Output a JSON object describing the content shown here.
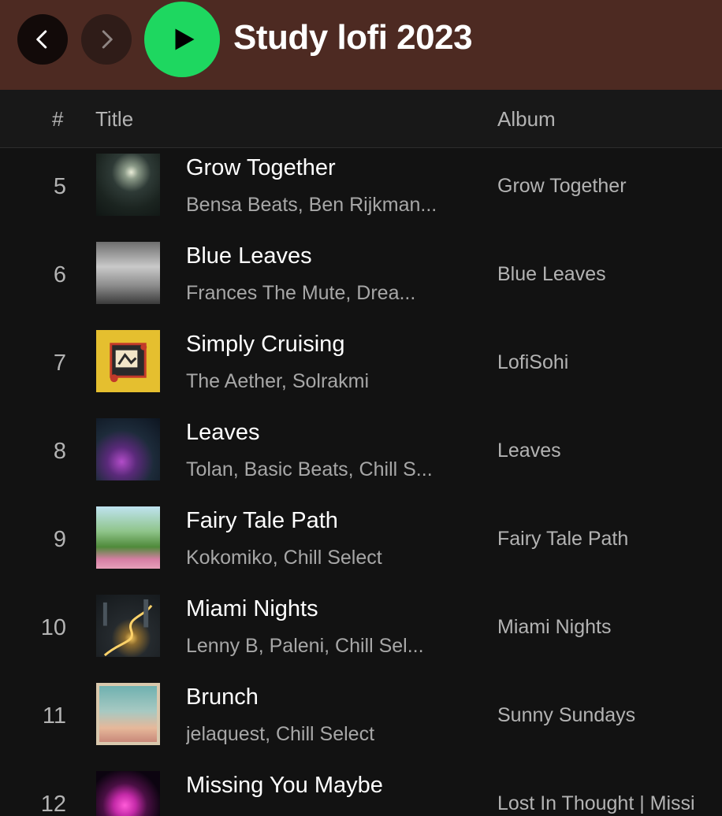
{
  "header": {
    "title": "Study lofi 2023",
    "back_icon": "chevron-left-icon",
    "forward_icon": "chevron-right-icon",
    "play_icon": "play-icon",
    "colors": {
      "header_bg": "#4d2a22",
      "play_green": "#1ed760"
    }
  },
  "columns": {
    "number": "#",
    "title": "Title",
    "album": "Album"
  },
  "tracks": [
    {
      "number": "5",
      "title": "Grow Together",
      "artists": "Bensa Beats, Ben Rijkman...",
      "album": "Grow Together"
    },
    {
      "number": "6",
      "title": "Blue Leaves",
      "artists": "Frances The Mute, Drea...",
      "album": "Blue Leaves"
    },
    {
      "number": "7",
      "title": "Simply Cruising",
      "artists": "The Aether, Solrakmi",
      "album": "LofiSohi"
    },
    {
      "number": "8",
      "title": "Leaves",
      "artists": "Tolan, Basic Beats, Chill S...",
      "album": "Leaves"
    },
    {
      "number": "9",
      "title": "Fairy Tale Path",
      "artists": "Kokomiko, Chill Select",
      "album": "Fairy Tale Path"
    },
    {
      "number": "10",
      "title": "Miami Nights",
      "artists": "Lenny B, Paleni, Chill Sel...",
      "album": "Miami Nights"
    },
    {
      "number": "11",
      "title": "Brunch",
      "artists": "jelaquest, Chill Select",
      "album": "Sunny Sundays"
    },
    {
      "number": "12",
      "title": "Missing You Maybe",
      "artists": "",
      "album": "Lost In Thought | Missi"
    }
  ]
}
